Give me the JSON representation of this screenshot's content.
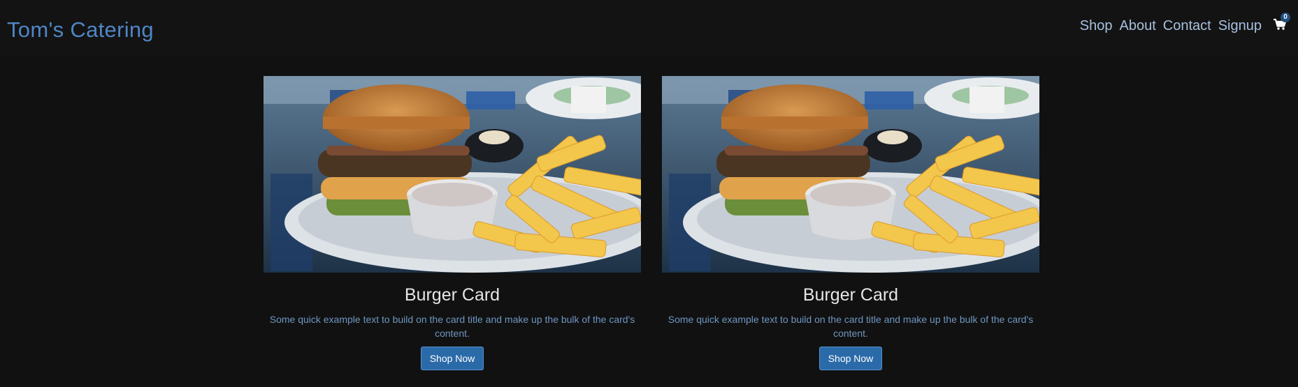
{
  "navbar": {
    "brand": "Tom's Catering",
    "links": [
      "Shop",
      "About",
      "Contact",
      "Signup"
    ],
    "cart": {
      "icon": "cart-icon",
      "count": "0"
    }
  },
  "cards": [
    {
      "title": "Burger Card",
      "text": "Some quick example text to build on the card title and make up the bulk of the card's content.",
      "button": "Shop Now",
      "image": "burger-and-fries-photo"
    },
    {
      "title": "Burger Card",
      "text": "Some quick example text to build on the card title and make up the bulk of the card's content.",
      "button": "Shop Now",
      "image": "burger-and-fries-photo"
    }
  ],
  "colors": {
    "background": "#111111",
    "brand": "#4f86c4",
    "nav_link": "#a7c0df",
    "card_text": "#6f96c2",
    "button": "#2b6aa8"
  }
}
